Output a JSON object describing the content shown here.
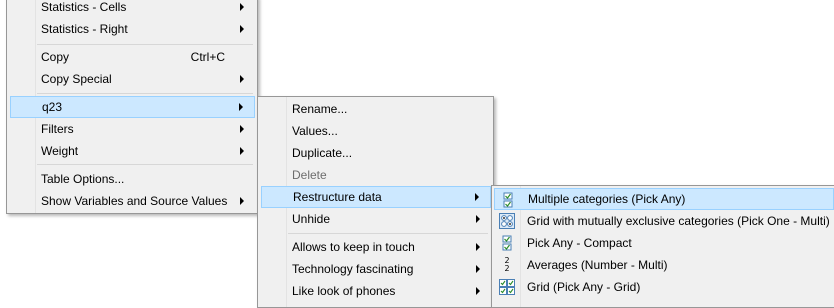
{
  "menu1": {
    "items": [
      {
        "label": "Statistics - Cells"
      },
      {
        "label": "Statistics - Right"
      },
      {
        "label": "Copy",
        "shortcut": "Ctrl+C"
      },
      {
        "label": "Copy Special"
      },
      {
        "label": "q23"
      },
      {
        "label": "Filters"
      },
      {
        "label": "Weight"
      },
      {
        "label": "Table Options..."
      },
      {
        "label": "Show Variables and Source Values"
      }
    ]
  },
  "menu2": {
    "items": [
      {
        "label": "Rename..."
      },
      {
        "label": "Values..."
      },
      {
        "label": "Duplicate..."
      },
      {
        "label": "Delete"
      },
      {
        "label": "Restructure data"
      },
      {
        "label": "Unhide"
      },
      {
        "label": "Allows to keep in touch"
      },
      {
        "label": "Technology fascinating"
      },
      {
        "label": "Like look of phones"
      }
    ]
  },
  "menu3": {
    "items": [
      {
        "label": "Multiple categories (Pick Any)",
        "icon": "checkbox-list-icon"
      },
      {
        "label": "Grid with mutually exclusive categories (Pick One - Multi)",
        "icon": "radio-grid-icon"
      },
      {
        "label": "Pick Any - Compact",
        "icon": "checkbox-list-icon"
      },
      {
        "label": "Averages (Number - Multi)",
        "icon": "number-list-icon",
        "glyphs": [
          "2",
          "2"
        ]
      },
      {
        "label": "Grid (Pick Any - Grid)",
        "icon": "checkbox-grid-icon"
      }
    ]
  },
  "colors": {
    "highlight": "#cce8ff",
    "highlight_border": "#99d1ff",
    "menu_bg": "#f0f0f0"
  }
}
